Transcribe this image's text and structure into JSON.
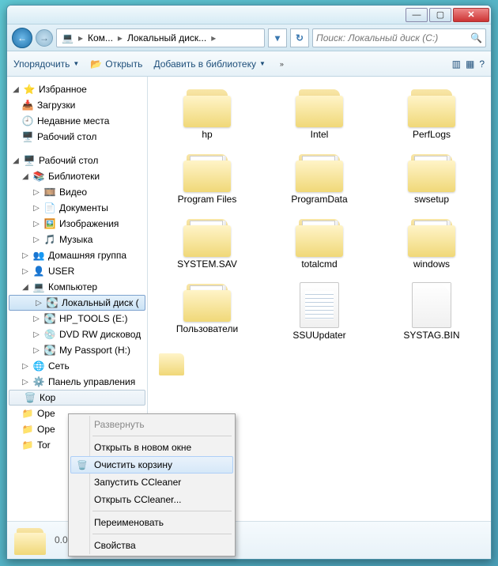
{
  "titlebar": {
    "min": "—",
    "max": "▢",
    "close": "✕"
  },
  "nav": {
    "back": "←",
    "fwd": "→",
    "refresh": "↻"
  },
  "breadcrumb": {
    "icon": "💻",
    "items": [
      "Ком...",
      "Локальный диск..."
    ],
    "sep": "▸"
  },
  "search": {
    "placeholder": "Поиск: Локальный диск (C:)",
    "icon": "🔍"
  },
  "toolbar": {
    "organize": "Упорядочить",
    "open": "Открыть",
    "open_icon": "📂",
    "library": "Добавить в библиотеку",
    "overflow": "»",
    "viewA": "▥",
    "viewB": "▦",
    "help": "?"
  },
  "tree": {
    "fav": "Избранное",
    "downloads": "Загрузки",
    "recent": "Недавние места",
    "desktop": "Рабочий стол",
    "desktop2": "Рабочий стол",
    "libraries": "Библиотеки",
    "video": "Видео",
    "docs": "Документы",
    "images": "Изображения",
    "music": "Музыка",
    "homegroup": "Домашняя группа",
    "user": "USER",
    "computer": "Компьютер",
    "localdisk": "Локальный диск (",
    "hptools": "HP_TOOLS (E:)",
    "dvd": "DVD RW дисковод",
    "passport": "My Passport (H:)",
    "network": "Сеть",
    "cpanel": "Панель управления",
    "recycle": "Кор",
    "open1": "Ope",
    "open2": "Ope",
    "tor": "Tor"
  },
  "files": [
    {
      "name": "hp",
      "type": "folder"
    },
    {
      "name": "Intel",
      "type": "folder"
    },
    {
      "name": "PerfLogs",
      "type": "folder"
    },
    {
      "name": "Program Files",
      "type": "folder-full"
    },
    {
      "name": "ProgramData",
      "type": "folder-full"
    },
    {
      "name": "swsetup",
      "type": "folder-full"
    },
    {
      "name": "SYSTEM.SAV",
      "type": "folder-full"
    },
    {
      "name": "totalcmd",
      "type": "folder-full"
    },
    {
      "name": "windows",
      "type": "folder-full"
    },
    {
      "name": "Пользователи",
      "type": "folder-full"
    },
    {
      "name": "SSUUpdater",
      "type": "file-lined"
    },
    {
      "name": "SYSTAG.BIN",
      "type": "file-blank"
    }
  ],
  "statusbar": {
    "date": "0.08.2016 11:05"
  },
  "context": {
    "expand": "Развернуть",
    "newwin": "Открыть в новом окне",
    "empty": "Очистить корзину",
    "ccleaner1": "Запустить CCleaner",
    "ccleaner2": "Открыть CCleaner...",
    "rename": "Переименовать",
    "props": "Свойства"
  }
}
